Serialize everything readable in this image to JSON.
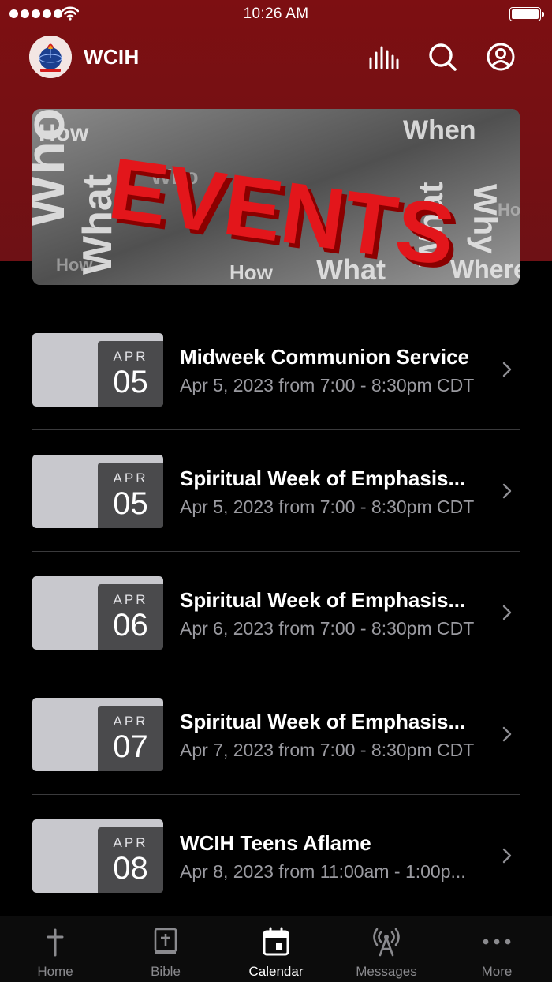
{
  "status_bar": {
    "time": "10:26 AM"
  },
  "header": {
    "title": "WCIH",
    "icons": [
      "audio-bars-icon",
      "search-icon",
      "account-icon"
    ]
  },
  "banner": {
    "headline": "EVENTS",
    "words": [
      "How",
      "When",
      "Who",
      "What",
      "Where",
      "Why"
    ]
  },
  "events": [
    {
      "month": "APR",
      "day": "05",
      "title": "Midweek Communion Service",
      "time": "Apr 5, 2023 from 7:00 - 8:30pm CDT"
    },
    {
      "month": "APR",
      "day": "05",
      "title": "Spiritual Week of Emphasis...",
      "time": "Apr 5, 2023 from 7:00 - 8:30pm CDT"
    },
    {
      "month": "APR",
      "day": "06",
      "title": "Spiritual Week of Emphasis...",
      "time": "Apr 6, 2023 from 7:00 - 8:30pm CDT"
    },
    {
      "month": "APR",
      "day": "07",
      "title": "Spiritual Week of Emphasis...",
      "time": "Apr 7, 2023 from 7:00 - 8:30pm CDT"
    },
    {
      "month": "APR",
      "day": "08",
      "title": "WCIH Teens Aflame",
      "time": "Apr 8, 2023 from 11:00am - 1:00p..."
    }
  ],
  "tabs": [
    {
      "label": "Home",
      "icon": "cross-icon",
      "active": false
    },
    {
      "label": "Bible",
      "icon": "bible-icon",
      "active": false
    },
    {
      "label": "Calendar",
      "icon": "calendar-icon",
      "active": true
    },
    {
      "label": "Messages",
      "icon": "broadcast-icon",
      "active": false
    },
    {
      "label": "More",
      "icon": "more-dots-icon",
      "active": false
    }
  ],
  "colors": {
    "header_red": "#7d0f12",
    "background": "#000000",
    "secondary_text": "#9a9aa0",
    "active_tab": "#ffffff",
    "inactive_tab": "#8a8a8e"
  }
}
